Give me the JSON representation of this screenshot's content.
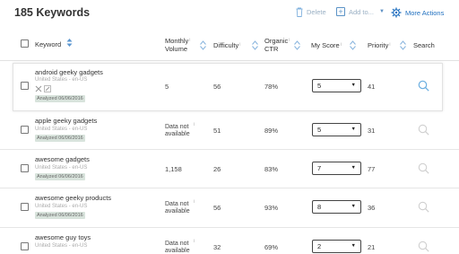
{
  "page": {
    "title": "185 Keywords"
  },
  "toolbar": {
    "delete_label": "Delete",
    "add_label": "Add to...",
    "more_label": "More Actions"
  },
  "columns": {
    "keyword": "Keyword",
    "monthly_line1": "Monthly",
    "monthly_line2": "Volume",
    "difficulty": "Difficulty",
    "organic_line1": "Organic",
    "organic_line2": "CTR",
    "my_score": "My Score",
    "priority": "Priority",
    "search": "Search",
    "info_marker": "i"
  },
  "rows": [
    {
      "keyword": "android geeky gadgets",
      "location": "United States - en-US",
      "analyzed": "Analyzed 06/06/2016",
      "volume": "5",
      "difficulty": "56",
      "ctr": "78%",
      "score": "5",
      "priority": "41"
    },
    {
      "keyword": "apple geeky gadgets",
      "location": "United States - en-US",
      "analyzed": "Analyzed 06/06/2016",
      "volume_line1": "Data not",
      "volume_line2": "available",
      "difficulty": "51",
      "ctr": "89%",
      "score": "5",
      "priority": "31"
    },
    {
      "keyword": "awesome gadgets",
      "location": "United States - en-US",
      "analyzed": "Analyzed 06/06/2016",
      "volume": "1,158",
      "difficulty": "26",
      "ctr": "83%",
      "score": "7",
      "priority": "77"
    },
    {
      "keyword": "awesome geeky products",
      "location": "United States - en-US",
      "analyzed": "Analyzed 06/06/2016",
      "volume_line1": "Data not",
      "volume_line2": "available",
      "difficulty": "56",
      "ctr": "93%",
      "score": "8",
      "priority": "36"
    },
    {
      "keyword": "awesome guy toys",
      "location": "United States - en-US",
      "volume_line1": "Data not",
      "volume_line2": "available",
      "difficulty": "32",
      "ctr": "69%",
      "score": "2",
      "priority": "21"
    }
  ],
  "icons": {
    "delete": "trash-icon",
    "add": "plus-square-icon",
    "more": "gear-icon",
    "sort": "sort-arrows-icon",
    "search": "magnifier-icon",
    "remove": "x-icon",
    "edit": "pencil-icon"
  },
  "colors": {
    "accent": "#1f6fbf",
    "muted_accent": "#9ab0c4",
    "badge_bg": "#d8e3dc",
    "search_active": "#6aaee0",
    "search_inactive": "#cfcfcf"
  }
}
